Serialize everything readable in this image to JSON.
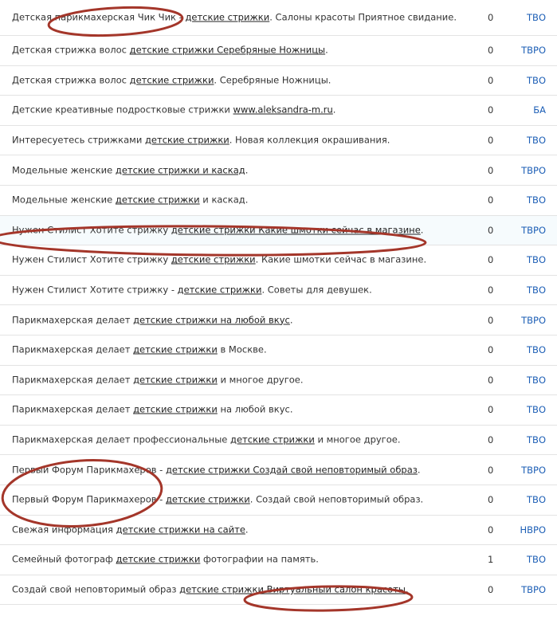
{
  "rows": [
    {
      "pre": "Детская парикмахерская Чик Чик - ",
      "link": "детские стрижки",
      "post": ". Салоны красоты Приятное свидание.",
      "count": "0",
      "kind": "ТВО"
    },
    {
      "pre": "Детская стрижка волос ",
      "link": "детские стрижки Серебряные Ножницы",
      "post": ".",
      "count": "0",
      "kind": "ТВРО"
    },
    {
      "pre": "Детская стрижка волос ",
      "link": "детские стрижки",
      "post": ". Серебряные Ножницы.",
      "count": "0",
      "kind": "ТВО"
    },
    {
      "pre": "Детские креативные подростковые стрижки ",
      "link": "www.aleksandra-m.ru",
      "post": ".",
      "count": "0",
      "kind": "БА"
    },
    {
      "pre": "Интересуетесь стрижками ",
      "link": "детские стрижки",
      "post": ". Новая коллекция окрашивания.",
      "count": "0",
      "kind": "ТВО"
    },
    {
      "pre": "Модельные женские ",
      "link": "детские стрижки и каскад",
      "post": ".",
      "count": "0",
      "kind": "ТВРО"
    },
    {
      "pre": "Модельные женские ",
      "link": "детские стрижки",
      "post": " и каскад.",
      "count": "0",
      "kind": "ТВО"
    },
    {
      "pre": "Нужен Стилист Хотите стрижку ",
      "link": "детские стрижки Какие шмотки сейчас в магазине",
      "post": ".",
      "count": "0",
      "kind": "ТВРО"
    },
    {
      "pre": "Нужен Стилист Хотите стрижку ",
      "link": "детские стрижки",
      "post": ". Какие шмотки сейчас в магазине.",
      "count": "0",
      "kind": "ТВО"
    },
    {
      "pre": "Нужен Стилист Хотите стрижку - ",
      "link": "детские стрижки",
      "post": ". Советы для девушек.",
      "count": "0",
      "kind": "ТВО"
    },
    {
      "pre": "Парикмахерская делает ",
      "link": "детские стрижки на любой вкус",
      "post": ".",
      "count": "0",
      "kind": "ТВРО"
    },
    {
      "pre": "Парикмахерская делает ",
      "link": "детские стрижки",
      "post": " в Москве.",
      "count": "0",
      "kind": "ТВО"
    },
    {
      "pre": "Парикмахерская делает ",
      "link": "детские стрижки",
      "post": " и многое другое.",
      "count": "0",
      "kind": "ТВО"
    },
    {
      "pre": "Парикмахерская делает ",
      "link": "детские стрижки",
      "post": " на любой вкус.",
      "count": "0",
      "kind": "ТВО"
    },
    {
      "pre": "Парикмахерская делает профессиональные ",
      "link": "детские стрижки",
      "post": " и многое другое.",
      "count": "0",
      "kind": "ТВО"
    },
    {
      "pre": "Первый Форум Парикмахеров - ",
      "link": "детские стрижки Создай свой неповторимый образ",
      "post": ".",
      "count": "0",
      "kind": "ТВРО"
    },
    {
      "pre": "Первый Форум Парикмахеров - ",
      "link": "детские стрижки",
      "post": ". Создай свой неповторимый образ.",
      "count": "0",
      "kind": "ТВО"
    },
    {
      "pre": "Свежая информация ",
      "link": "детские стрижки на сайте",
      "post": ".",
      "count": "0",
      "kind": "НВРО"
    },
    {
      "pre": "Семейный фотограф ",
      "link": "детские стрижки",
      "post": " фотографии на память.",
      "count": "1",
      "kind": "ТВО"
    },
    {
      "pre": "Создай свой неповторимый образ ",
      "link": "детские стрижки Виртуальный салон красоты",
      "post": ".",
      "count": "0",
      "kind": "ТВРО"
    }
  ]
}
